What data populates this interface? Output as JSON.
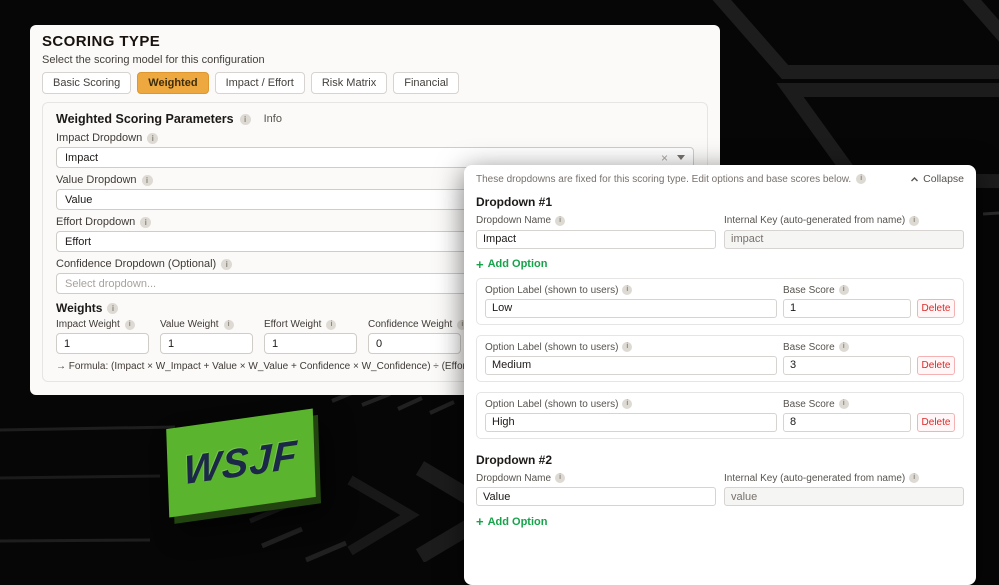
{
  "colors": {
    "active_tab_bg": "#EDA940",
    "add_option_green": "#16A34A",
    "delete_red": "#DC2626",
    "sticker_green": "#5BB42E"
  },
  "sticker": {
    "text": "WSJF"
  },
  "scoring_type": {
    "title": "SCORING TYPE",
    "subtitle": "Select the scoring model for this configuration",
    "tabs": [
      {
        "label": "Basic Scoring"
      },
      {
        "label": "Weighted"
      },
      {
        "label": "Impact / Effort"
      },
      {
        "label": "Risk Matrix"
      },
      {
        "label": "Financial"
      }
    ],
    "active_tab": "Weighted"
  },
  "weighted_params": {
    "title": "Weighted Scoring Parameters",
    "info_link": "Info",
    "dropdowns": [
      {
        "label": "Impact Dropdown",
        "value": "Impact"
      },
      {
        "label": "Value Dropdown",
        "value": "Value"
      },
      {
        "label": "Effort Dropdown",
        "value": "Effort"
      },
      {
        "label": "Confidence Dropdown (Optional)",
        "value": "Select dropdown..."
      }
    ],
    "weights": {
      "title": "Weights",
      "items": [
        {
          "label": "Impact Weight",
          "value": "1"
        },
        {
          "label": "Value Weight",
          "value": "1"
        },
        {
          "label": "Effort Weight",
          "value": "1"
        },
        {
          "label": "Confidence Weight",
          "value": "0"
        }
      ]
    },
    "formula": "→ Formula: (Impact × W_Impact + Value × W_Value + Confidence × W_Confidence) ÷ (Effort × W_Effort)"
  },
  "options_editor": {
    "notice": "These dropdowns are fixed for this scoring type. Edit options and base scores below.",
    "collapse_label": "Collapse",
    "labels": {
      "dropdown_name": "Dropdown Name",
      "internal_key": "Internal Key (auto-generated from name)",
      "option_label": "Option Label (shown to users)",
      "base_score": "Base Score",
      "add_option": "Add Option",
      "delete": "Delete"
    },
    "dropdowns": [
      {
        "title": "Dropdown #1",
        "name": "Impact",
        "internal_key": "impact",
        "options": [
          {
            "label": "Low",
            "base_score": "1"
          },
          {
            "label": "Medium",
            "base_score": "3"
          },
          {
            "label": "High",
            "base_score": "8"
          }
        ]
      },
      {
        "title": "Dropdown #2",
        "name": "Value",
        "internal_key": "value",
        "options": []
      }
    ]
  }
}
